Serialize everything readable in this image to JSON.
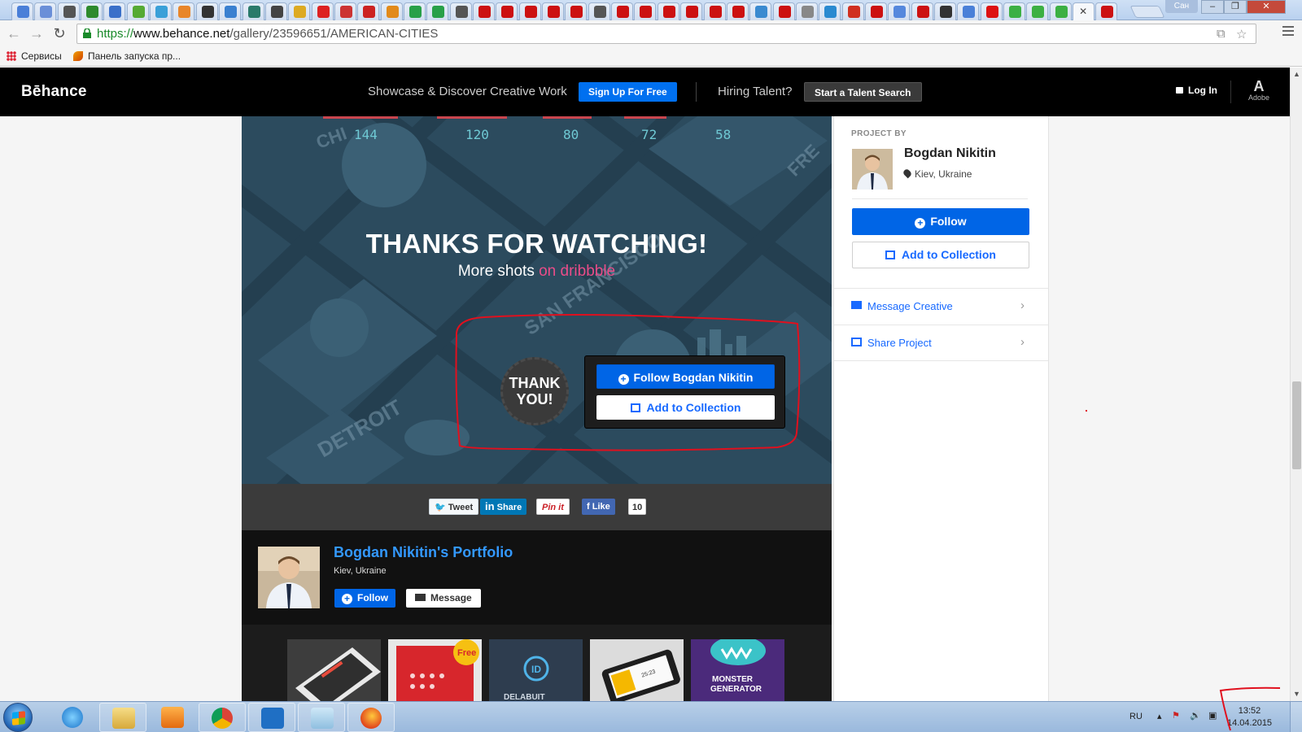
{
  "browser": {
    "url_scheme": "https://",
    "url_host": "www.behance.net",
    "url_path": "/gallery/23596651/AMERICAN-CITIES",
    "profile_label": "Сан",
    "bookmarks": [
      {
        "label": "Сервисы",
        "icon": "apps-grid-icon"
      },
      {
        "label": "Панель запуска пр...",
        "icon": "rocket-icon"
      }
    ]
  },
  "behance_header": {
    "logo": "Bēhance",
    "tagline": "Showcase & Discover Creative Work",
    "signup_label": "Sign Up For Free",
    "hiring_label": "Hiring Talent?",
    "talent_search_label": "Start a Talent Search",
    "login_label": "Log In",
    "adobe_label": "Adobe"
  },
  "project": {
    "stats": [
      "144",
      "120",
      "80",
      "72",
      "58"
    ],
    "thanks_title": "THANKS FOR WATCHING!",
    "thanks_sub_prefix": "More shots ",
    "thanks_sub_link": "on dribbble",
    "badge_line1": "THANK",
    "badge_line2": "YOU!",
    "overlay_follow_label": "Follow Bogdan Nikitin",
    "overlay_collection_label": "Add to Collection",
    "map_labels": [
      "DETROIT",
      "SAN FRANCISCO",
      "CHI",
      "FRE"
    ]
  },
  "share": {
    "tweet_label": "Tweet",
    "linkedin_label": "Share",
    "pinterest_label": "Pin it",
    "facebook_label": "Like",
    "facebook_count": "10"
  },
  "portfolio": {
    "title": "Bogdan Nikitin's Portfolio",
    "location": "Kiev, Ukraine",
    "follow_label": "Follow",
    "message_label": "Message",
    "thumbnails": [
      {
        "name": "thumb-ui-tablet",
        "caption": ""
      },
      {
        "name": "thumb-free-icons",
        "caption": "Free"
      },
      {
        "name": "thumb-delabuit",
        "caption": "DELABUIT"
      },
      {
        "name": "thumb-phone-app",
        "caption": "25:23"
      },
      {
        "name": "thumb-monster-generator",
        "caption": "MONSTER GENERATOR"
      }
    ]
  },
  "sidebar": {
    "project_by_label": "PROJECT BY",
    "author_name": "Bogdan Nikitin",
    "author_location": "Kiev, Ukraine",
    "follow_label": "Follow",
    "collection_label": "Add to Collection",
    "message_label": "Message Creative",
    "share_label": "Share Project"
  },
  "taskbar": {
    "language": "RU",
    "time": "13:52",
    "date": "14.04.2015",
    "apps": [
      "internet-explorer",
      "file-explorer",
      "media-player",
      "chrome",
      "maxthon",
      "notepad",
      "firefox"
    ]
  },
  "colors": {
    "behance_blue": "#0065e6",
    "link_blue": "#1769ff",
    "dribbble_pink": "#ea4c89",
    "annotation_red": "#e0101e"
  }
}
